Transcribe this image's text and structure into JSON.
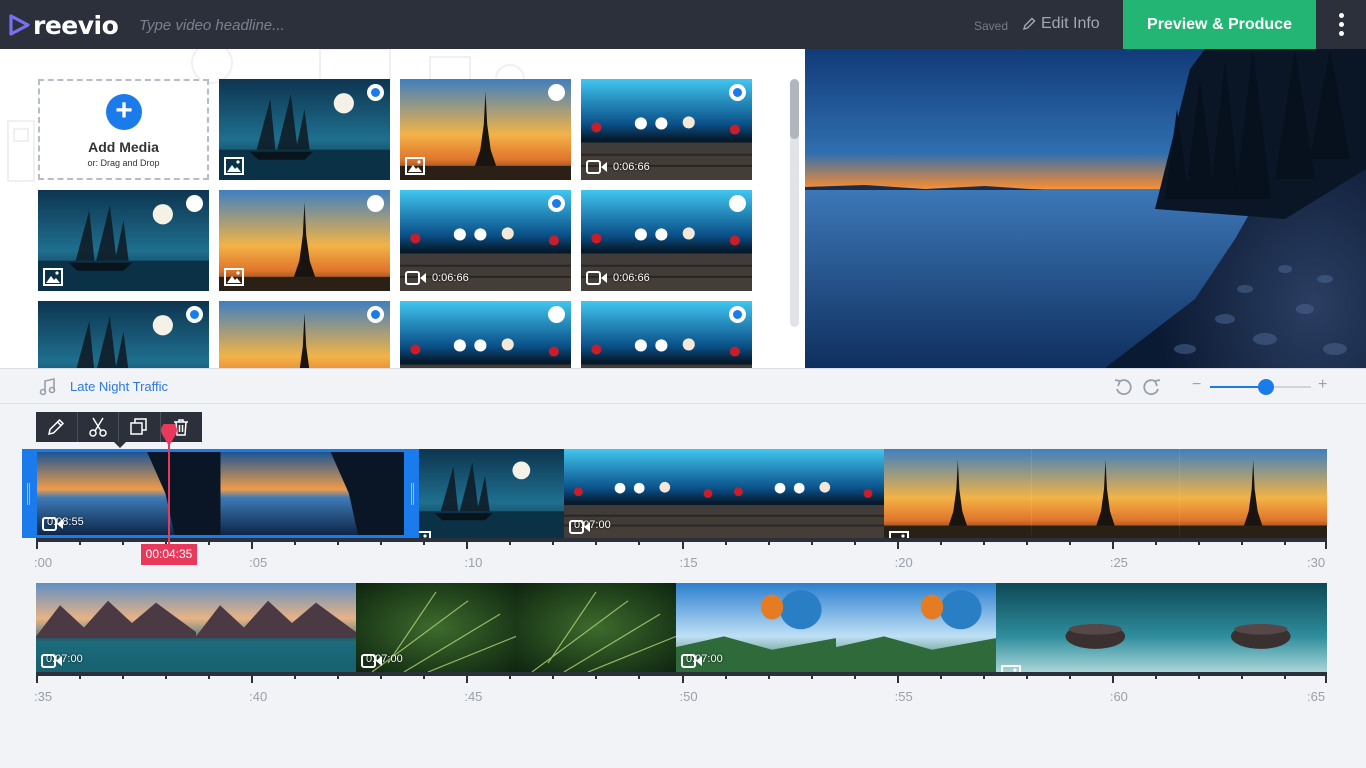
{
  "app": {
    "name": "reevio"
  },
  "header": {
    "headline_placeholder": "Type video headline...",
    "saved_label": "Saved",
    "edit_info_label": "Edit Info",
    "produce_label": "Preview & Produce"
  },
  "library": {
    "add_media_title": "Add Media",
    "add_media_subtitle": "or: Drag and Drop",
    "tiles": [
      {
        "kind": "image",
        "scene": "ship",
        "selected": true
      },
      {
        "kind": "image",
        "scene": "eiffel",
        "selected": false
      },
      {
        "kind": "video",
        "scene": "bokeh",
        "duration": "0:06:66",
        "selected": true
      },
      {
        "kind": "image",
        "scene": "ship",
        "selected": false
      },
      {
        "kind": "image",
        "scene": "eiffel",
        "selected": false
      },
      {
        "kind": "video",
        "scene": "bokeh",
        "duration": "0:06:66",
        "selected": true
      },
      {
        "kind": "video",
        "scene": "bokeh",
        "duration": "0:06:66",
        "selected": false
      },
      {
        "kind": "image",
        "scene": "ship",
        "selected": true
      },
      {
        "kind": "image",
        "scene": "eiffel",
        "selected": true
      },
      {
        "kind": "video",
        "scene": "bokeh",
        "selected": false
      },
      {
        "kind": "video",
        "scene": "bokeh",
        "selected": true
      }
    ]
  },
  "audio": {
    "track_title": "Late Night Traffic"
  },
  "zoom": {
    "level": 0.55
  },
  "timeline": {
    "clip_tools": [
      "edit-icon",
      "scissors-icon",
      "duplicate-icon",
      "trash-icon"
    ],
    "playhead_time": "00:04:35",
    "row1": {
      "selected_clip": {
        "kind": "video",
        "scene": "lake",
        "duration": "0:08:55"
      },
      "clips": [
        {
          "kind": "image",
          "scene": "ship"
        },
        {
          "kind": "video",
          "scene": "bokeh",
          "duration": "0:07:00"
        },
        {
          "kind": "image",
          "scene": "eiffel"
        }
      ],
      "ruler_labels": [
        ":00",
        ":05",
        ":10",
        ":15",
        ":20",
        ":25",
        ":30"
      ]
    },
    "row2": {
      "clips": [
        {
          "kind": "video",
          "scene": "mountains",
          "duration": "0:07:00"
        },
        {
          "kind": "video",
          "scene": "pine",
          "duration": "0:07:00"
        },
        {
          "kind": "video",
          "scene": "balloons",
          "duration": "0:07:00"
        },
        {
          "kind": "image",
          "scene": "stone"
        }
      ],
      "ruler_labels": [
        ":35",
        ":40",
        ":45",
        ":50",
        ":55",
        ":60",
        ":65"
      ]
    }
  },
  "colors": {
    "accent": "#1c7bea",
    "produce": "#22b573",
    "playhead": "#e8395c",
    "topbar": "#2c303b"
  }
}
